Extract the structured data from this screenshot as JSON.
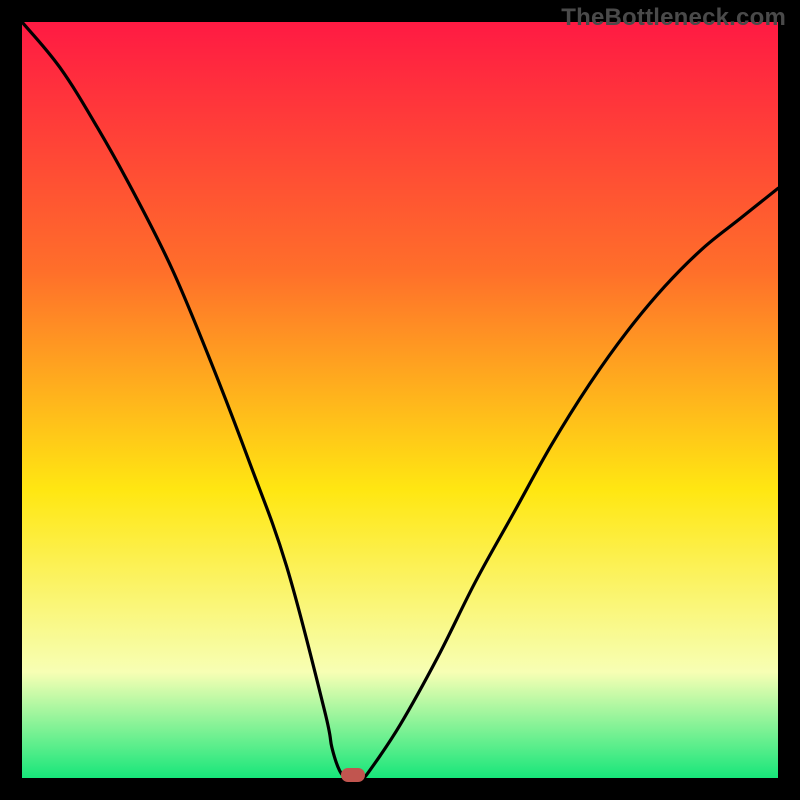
{
  "watermark": "TheBottleneck.com",
  "colors": {
    "frame": "#000000",
    "curve": "#000000",
    "gradient_top": "#ff1a43",
    "gradient_mid1": "#ff6f2a",
    "gradient_mid2": "#ffe712",
    "gradient_mid3": "#f7ffb4",
    "gradient_bottom": "#17e67a",
    "marker": "#c1554f"
  },
  "chart_data": {
    "type": "line",
    "title": "",
    "xlabel": "",
    "ylabel": "",
    "xlim": [
      0,
      100
    ],
    "ylim": [
      0,
      100
    ],
    "grid": false,
    "legend": false,
    "notes": "V-shaped bottleneck curve. Vertical-gradient background from red (top) through orange/yellow to green (bottom). Minimum near x≈43, y≈0. Small rounded marker at the trough.",
    "series": [
      {
        "name": "bottleneck-curve",
        "x": [
          0,
          5,
          10,
          15,
          20,
          25,
          30,
          35,
          40,
          41,
          42,
          43,
          44,
          45,
          46,
          50,
          55,
          60,
          65,
          70,
          75,
          80,
          85,
          90,
          95,
          100
        ],
        "y": [
          100,
          94,
          86,
          77,
          67,
          55,
          42,
          28,
          9,
          4,
          1,
          0,
          0,
          0,
          1,
          7,
          16,
          26,
          35,
          44,
          52,
          59,
          65,
          70,
          74,
          78
        ]
      }
    ],
    "marker": {
      "x": 43.8,
      "y": 0,
      "shape": "rounded-rect"
    }
  }
}
